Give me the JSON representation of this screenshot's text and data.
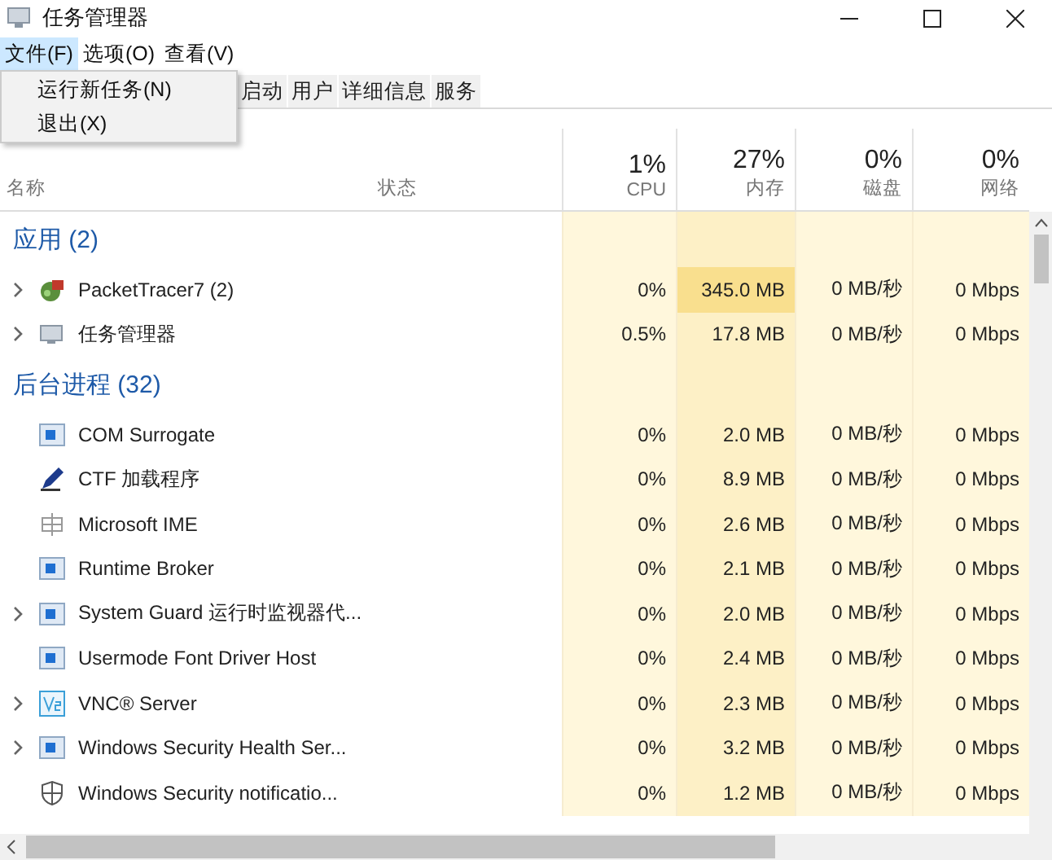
{
  "window": {
    "title": "任务管理器"
  },
  "menu": [
    {
      "label": "文件(F)",
      "selected": true
    },
    {
      "label": "选项(O)",
      "selected": false
    },
    {
      "label": "查看(V)",
      "selected": false
    }
  ],
  "dropdown": [
    "运行新任务(N)",
    "退出(X)"
  ],
  "tabs": [
    "启动",
    "用户",
    "详细信息",
    "服务"
  ],
  "columns": [
    {
      "label": "名称"
    },
    {
      "label": "状态"
    },
    {
      "usage": "1%",
      "label": "CPU"
    },
    {
      "usage": "27%",
      "label": "内存"
    },
    {
      "usage": "0%",
      "label": "磁盘"
    },
    {
      "usage": "0%",
      "label": "网络"
    }
  ],
  "groups": [
    {
      "title": "应用 (2)",
      "rows": [
        {
          "name": "PacketTracer7 (2)",
          "kind": "packet",
          "expandable": true,
          "highlighted": true,
          "values": [
            "0%",
            "345.0 MB",
            "0 MB/秒",
            "0 Mbps"
          ]
        },
        {
          "name": "任务管理器",
          "kind": "taskmgr",
          "expandable": true,
          "highlighted": false,
          "values": [
            "0.5%",
            "17.8 MB",
            "0 MB/秒",
            "0 Mbps"
          ]
        }
      ]
    },
    {
      "title": "后台进程 (32)",
      "rows": [
        {
          "name": "COM Surrogate",
          "kind": "window",
          "expandable": false,
          "highlighted": false,
          "values": [
            "0%",
            "2.0 MB",
            "0 MB/秒",
            "0 Mbps"
          ]
        },
        {
          "name": "CTF 加载程序",
          "kind": "pen",
          "expandable": false,
          "highlighted": false,
          "values": [
            "0%",
            "8.9 MB",
            "0 MB/秒",
            "0 Mbps"
          ]
        },
        {
          "name": "Microsoft IME",
          "kind": "ime",
          "expandable": false,
          "highlighted": false,
          "values": [
            "0%",
            "2.6 MB",
            "0 MB/秒",
            "0 Mbps"
          ]
        },
        {
          "name": "Runtime Broker",
          "kind": "window",
          "expandable": false,
          "highlighted": false,
          "values": [
            "0%",
            "2.1 MB",
            "0 MB/秒",
            "0 Mbps"
          ]
        },
        {
          "name": "System Guard 运行时监视器代...",
          "kind": "window",
          "expandable": true,
          "highlighted": false,
          "values": [
            "0%",
            "2.0 MB",
            "0 MB/秒",
            "0 Mbps"
          ]
        },
        {
          "name": "Usermode Font Driver Host",
          "kind": "window",
          "expandable": false,
          "highlighted": false,
          "values": [
            "0%",
            "2.4 MB",
            "0 MB/秒",
            "0 Mbps"
          ]
        },
        {
          "name": "VNC® Server",
          "kind": "vnc",
          "expandable": true,
          "highlighted": false,
          "values": [
            "0%",
            "2.3 MB",
            "0 MB/秒",
            "0 Mbps"
          ]
        },
        {
          "name": "Windows Security Health Ser...",
          "kind": "window",
          "expandable": true,
          "highlighted": false,
          "values": [
            "0%",
            "3.2 MB",
            "0 MB/秒",
            "0 Mbps"
          ]
        },
        {
          "name": "Windows Security notificatio...",
          "kind": "shield",
          "expandable": false,
          "highlighted": false,
          "values": [
            "0%",
            "1.2 MB",
            "0 MB/秒",
            "0 Mbps"
          ]
        }
      ]
    }
  ]
}
